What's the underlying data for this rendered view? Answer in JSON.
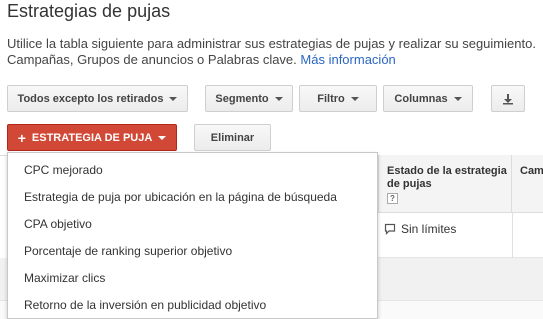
{
  "header": {
    "title": "Estrategias de pujas",
    "description": "Utilice la tabla siguiente para administrar sus estrategias de pujas y realizar su seguimiento. Campañas, Grupos de anuncios o Palabras clave.",
    "more_info_link": "Más información"
  },
  "toolbar": {
    "filter_all_label": "Todos excepto los retirados",
    "segment_label": "Segmento",
    "filter_label": "Filtro",
    "columns_label": "Columnas",
    "download_icon": "download-icon"
  },
  "actions": {
    "strategy_button_label": "ESTRATEGIA DE PUJA",
    "delete_button_label": "Eliminar",
    "accent_color": "#d14836"
  },
  "table": {
    "columns": [
      {
        "label": "Estado de la estrategia de pujas",
        "help": "?"
      },
      {
        "label": "Cam"
      }
    ],
    "rows": [
      {
        "status": "Sin límites",
        "status_icon": "speech-bubble-icon"
      }
    ]
  },
  "menu": {
    "items": [
      {
        "label": "CPC mejorado"
      },
      {
        "label": "Estrategia de puja por ubicación en la página de búsqueda"
      },
      {
        "label": "CPA objetivo"
      },
      {
        "label": "Porcentaje de ranking superior objetivo"
      },
      {
        "label": "Maximizar clics"
      },
      {
        "label": "Retorno de la inversión en publicidad objetivo"
      }
    ]
  }
}
